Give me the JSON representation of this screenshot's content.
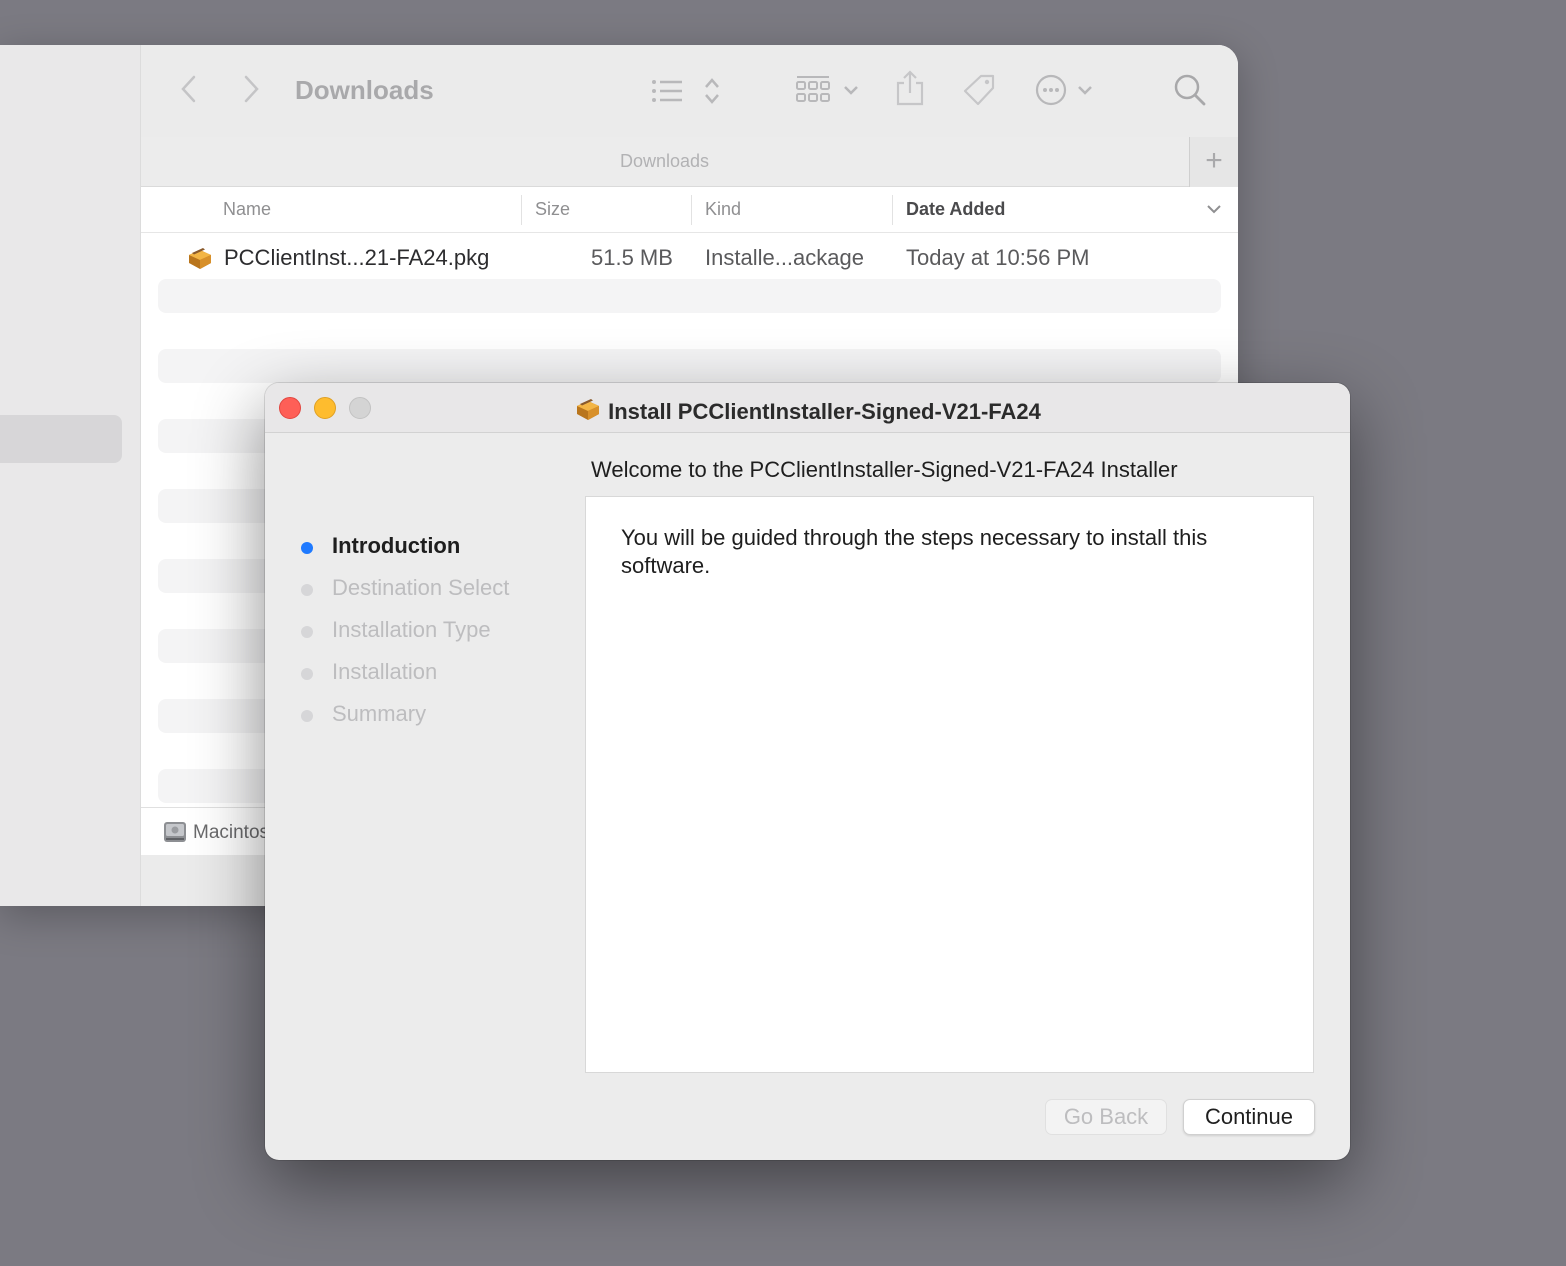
{
  "finder": {
    "title": "Downloads",
    "path_label": "Downloads",
    "add_tab_glyph": "+",
    "columns": {
      "name": "Name",
      "size": "Size",
      "kind": "Kind",
      "date_added": "Date Added"
    },
    "files": [
      {
        "name": "PCClientInst...21-FA24.pkg",
        "size": "51.5 MB",
        "kind": "Installe...ackage",
        "date_added": "Today at 10:56 PM",
        "icon": "package-icon"
      }
    ],
    "status_bar": {
      "disk_label": "Macintosh HD"
    }
  },
  "installer": {
    "title": "Install PCClientInstaller-Signed-V21-FA24",
    "welcome": "Welcome to the PCClientInstaller-Signed-V21-FA24 Installer",
    "steps": [
      {
        "label": "Introduction",
        "active": true
      },
      {
        "label": "Destination Select",
        "active": false
      },
      {
        "label": "Installation Type",
        "active": false
      },
      {
        "label": "Installation",
        "active": false
      },
      {
        "label": "Summary",
        "active": false
      }
    ],
    "body_text": "You will be guided through the steps necessary to install this software.",
    "buttons": {
      "go_back": "Go Back",
      "continue": "Continue"
    }
  },
  "colors": {
    "desktop": "#7b7a82",
    "active_step": "#1f7aff",
    "close": "#fe5f57",
    "minimize": "#febc2e",
    "zoom_disabled": "#d4d4d4"
  }
}
